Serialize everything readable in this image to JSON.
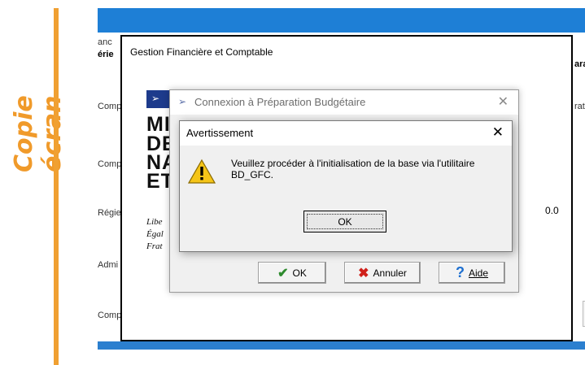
{
  "watermark": {
    "text": "Copie écran",
    "color": "#f09a2a"
  },
  "background_app": {
    "labels": [
      "anc",
      "érie",
      "Comp",
      "Comp",
      "Régie",
      "Admi",
      "Comp"
    ],
    "right_labels": [
      "ara",
      "rat"
    ]
  },
  "main_window": {
    "title": "Gestion Financière et Comptable",
    "logo_lines": [
      "MI",
      "DE",
      "NA",
      "ET"
    ],
    "motto_lines": [
      "Libe",
      "Égal",
      "Frat"
    ],
    "version": "0.0"
  },
  "connexion_dialog": {
    "title": "Connexion à Préparation Budgétaire",
    "buttons": {
      "ok": "OK",
      "annuler": "Annuler",
      "aide": "Aide"
    }
  },
  "warning_dialog": {
    "title": "Avertissement",
    "message": "Veuillez procéder à l'initialisation de la base via l'utilitaire BD_GFC.",
    "ok": "OK"
  },
  "colors": {
    "accent": "#1e7fd6",
    "orange": "#f0a032",
    "logo_blue": "#1d3b8c"
  }
}
